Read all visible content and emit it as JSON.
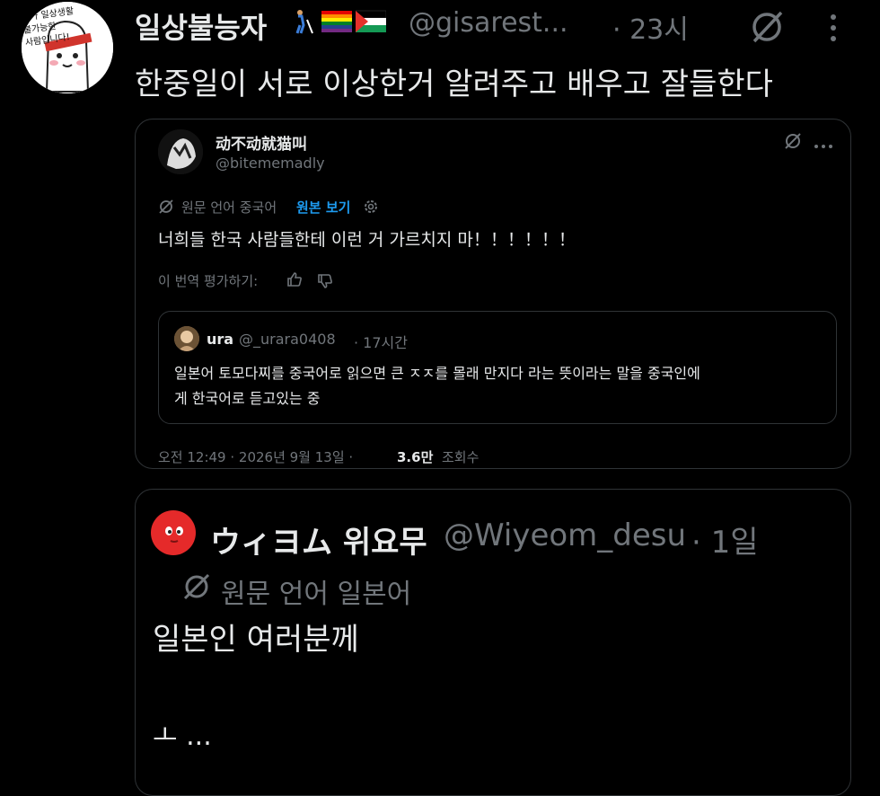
{
  "post": {
    "author_name": "일상불능자",
    "handle": "@gisarest...",
    "time": "· 23시",
    "text": "한중일이 서로 이상한거 알려주고 배우고 잘들한다",
    "avatar_text_lines": [
      "세가 일상생활",
      "불가능한",
      "사람입니다!"
    ]
  },
  "quoted": {
    "name": "动不动就猫叫",
    "handle": "@bitememadly",
    "translate_prefix": "원문 언어 중국어",
    "translate_link": "원본 보기",
    "text": "너희들 한국 사람들한테 이런 거 가르치지 마！！！！！！",
    "rate_label": "이 번역 평가하기:",
    "footer_time": "오전 12:49 · 2026년 9월 13일 ·",
    "footer_views_num": "3.6만",
    "footer_views_label": "조회수",
    "nested": {
      "name": "ura",
      "handle": "@_urara0408",
      "time": "· 17시간",
      "text_line1": "일본어 토모다찌를 중국어로 읽으면 큰 ㅈㅈ를 몰래 만지다 라는 뜻이라는 말을 중국인에",
      "text_line2": "게 한국어로 듣고있는 중"
    }
  },
  "second": {
    "name": "ウィヨム 위요무",
    "handle": "@Wiyeom_desu",
    "time": "· 1일",
    "translate_prefix": "원문 언어 일본어",
    "text_line1": "일본인 여러분께",
    "text_line2": "ㅗ ..."
  },
  "colors": {
    "background": "#000000",
    "text": "#e7e9ea",
    "muted": "#71767b",
    "link": "#1d9bf0",
    "border": "#2f3336"
  },
  "icons": {
    "grok": "grok-icon",
    "more": "more-icon",
    "translate": "translate-icon",
    "gear": "gear-icon",
    "thumbs_up": "thumbs-up-icon",
    "thumbs_down": "thumbs-down-icon"
  }
}
